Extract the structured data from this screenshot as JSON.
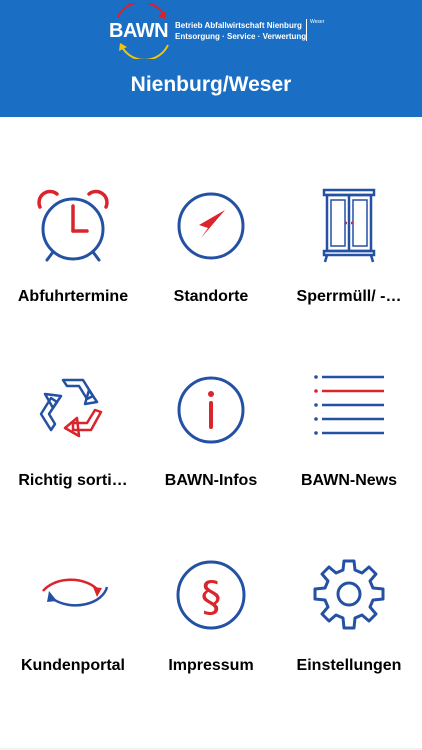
{
  "header": {
    "logo_word": "BAWN",
    "logo_tagline_1": "Betrieb Abfallwirtschaft Nienburg",
    "logo_tagline_2": "Entsorgung · Service · Verwertung",
    "logo_sub": "Weser",
    "title": "Nienburg/Weser"
  },
  "menu": [
    {
      "label": "Abfuhrtermine",
      "icon": "alarm-clock-icon"
    },
    {
      "label": "Standorte",
      "icon": "compass-icon"
    },
    {
      "label": "Sperrmüll/ -…",
      "icon": "wardrobe-icon"
    },
    {
      "label": "Richtig sorti…",
      "icon": "recycle-icon"
    },
    {
      "label": "BAWN-Infos",
      "icon": "info-icon"
    },
    {
      "label": "BAWN-News",
      "icon": "news-list-icon"
    },
    {
      "label": "Kundenportal",
      "icon": "exchange-arrows-icon"
    },
    {
      "label": "Impressum",
      "icon": "paragraph-icon"
    },
    {
      "label": "Einstellungen",
      "icon": "gear-icon"
    }
  ],
  "colors": {
    "brand_blue": "#1a6fc4",
    "icon_blue": "#2451a3",
    "icon_red": "#d9252b"
  }
}
